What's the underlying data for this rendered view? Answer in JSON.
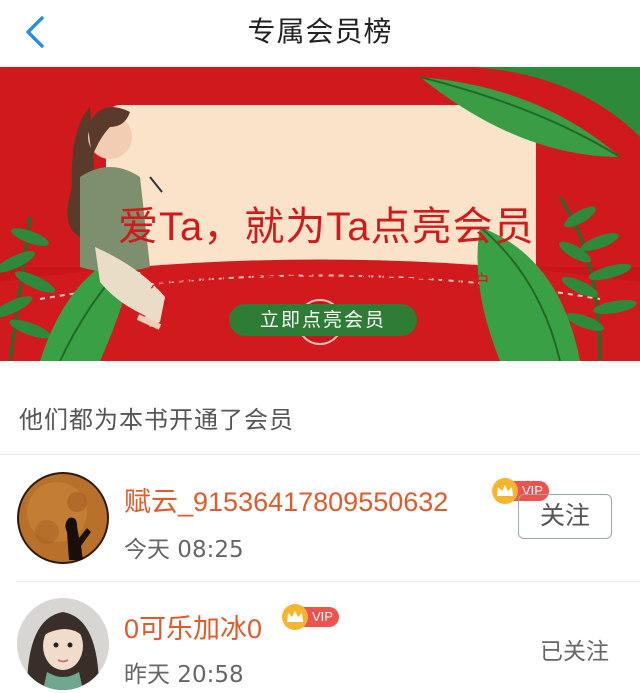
{
  "header": {
    "title": "专属会员榜",
    "back_icon": "chevron-left-icon"
  },
  "banner": {
    "headline": "爱Ta，就为Ta点亮会员",
    "subtitle": "点亮成功，收益立刻同步到作者大大账户",
    "button_label": "立即点亮会员",
    "colors": {
      "background": "#d0191c",
      "card": "#fbe3c9",
      "button": "#2f7c34",
      "text": "#d21a1d"
    }
  },
  "section": {
    "title": "他们都为本书开通了会员"
  },
  "members": [
    {
      "name": "赋云_915364178095506​32",
      "vip_label": "VIP",
      "time": "今天 08:25",
      "action_label": "关注"
    },
    {
      "name": "0可乐加冰0",
      "vip_label": "VIP",
      "time": "昨天 20:58",
      "action_label": "已关注"
    }
  ],
  "accent_color": "#e05a2a"
}
